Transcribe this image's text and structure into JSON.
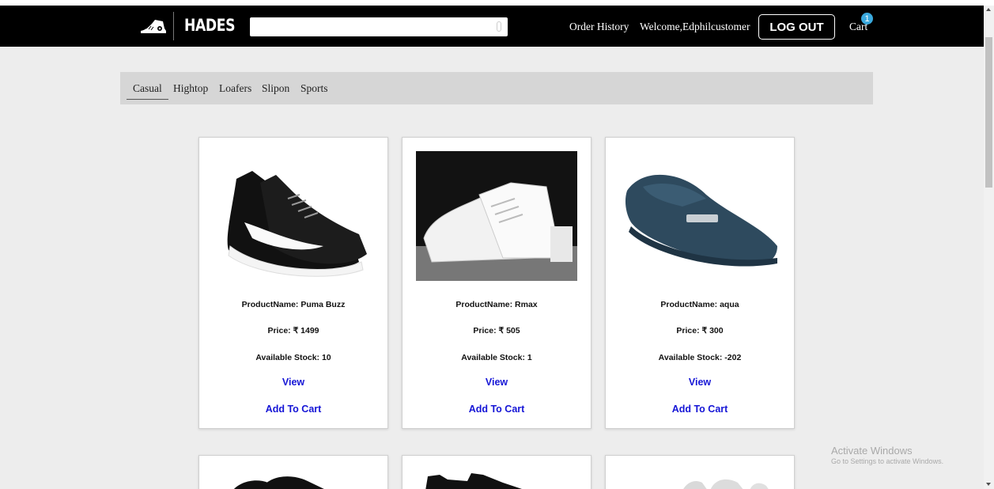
{
  "header": {
    "brand": "HADES",
    "search_placeholder": "",
    "nav_order_history": "Order History",
    "welcome": "Welcome,Edphilcustomer",
    "logout": "LOG OUT",
    "cart": "Cart",
    "cart_count": "1"
  },
  "categories": [
    "Casual",
    "Hightop",
    "Loafers",
    "Slipon",
    "Sports"
  ],
  "products": [
    {
      "name": "ProductName: Puma Buzz",
      "price": "Price: ₹ 1499",
      "stock": "Available Stock: 10",
      "view": "View",
      "add_to_cart": "Add To Cart",
      "image_icon": "black-sneaker"
    },
    {
      "name": "ProductName: Rmax",
      "price": "Price: ₹ 505",
      "stock": "Available Stock: 1",
      "view": "View",
      "add_to_cart": "Add To Cart",
      "image_icon": "white-hightop-sneaker"
    },
    {
      "name": "ProductName: aqua",
      "price": "Price: ₹ 300",
      "stock": "Available Stock: -202",
      "view": "View",
      "add_to_cart": "Add To Cart",
      "image_icon": "navy-loafer"
    }
  ],
  "watermark": {
    "title": "Activate Windows",
    "subtitle": "Go to Settings to activate Windows."
  },
  "colors": {
    "navbar": "#000000",
    "page_background": "#ededed",
    "category_bar": "#d6d6d6",
    "link_blue": "#1515d6",
    "badge": "#3aa9de"
  }
}
